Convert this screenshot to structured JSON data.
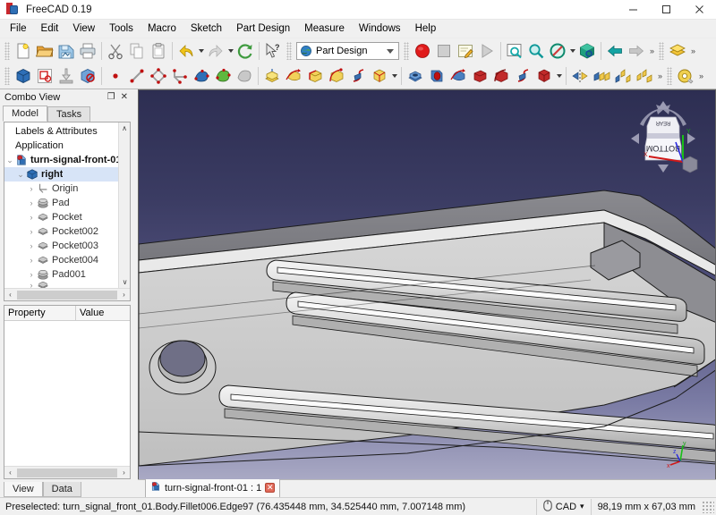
{
  "window": {
    "title": "FreeCAD 0.19",
    "app_icon": "freecad-logo-icon",
    "minimize": "–",
    "maximize": "☐",
    "close": "✕"
  },
  "menubar": {
    "items": [
      {
        "label": "File"
      },
      {
        "label": "Edit"
      },
      {
        "label": "View"
      },
      {
        "label": "Tools"
      },
      {
        "label": "Macro"
      },
      {
        "label": "Sketch"
      },
      {
        "label": "Part Design"
      },
      {
        "label": "Measure"
      },
      {
        "label": "Windows"
      },
      {
        "label": "Help"
      }
    ]
  },
  "toolbars": {
    "row1": [
      {
        "name": "new-document-button",
        "icon": "new-document-icon"
      },
      {
        "name": "open-document-button",
        "icon": "open-folder-icon"
      },
      {
        "name": "save-document-button",
        "icon": "save-icon"
      },
      {
        "name": "print-button",
        "icon": "printer-icon"
      },
      {
        "name": "separator",
        "icon": "separator"
      },
      {
        "name": "cut-button",
        "icon": "scissors-icon"
      },
      {
        "name": "copy-button",
        "icon": "copy-icon"
      },
      {
        "name": "paste-button",
        "icon": "clipboard-paste-icon"
      },
      {
        "name": "separator",
        "icon": "separator"
      },
      {
        "name": "undo-button",
        "icon": "undo-arrow-icon",
        "dropdown": true
      },
      {
        "name": "redo-button",
        "icon": "redo-arrow-icon",
        "dropdown": true
      },
      {
        "name": "refresh-button",
        "icon": "refresh-icon"
      },
      {
        "name": "separator",
        "icon": "separator"
      },
      {
        "name": "whats-this-button",
        "icon": "cursor-question-icon"
      }
    ],
    "workbench_selector": {
      "name": "workbench-selector",
      "value": "Part Design",
      "icon": "workbench-icon"
    },
    "row1b": [
      {
        "name": "macro-record-button",
        "icon": "record-red-circle-icon"
      },
      {
        "name": "macro-stop-button",
        "icon": "stop-square-icon"
      },
      {
        "name": "macro-edit-button",
        "icon": "macro-edit-icon"
      },
      {
        "name": "macro-execute-button",
        "icon": "play-triangle-icon"
      },
      {
        "name": "separator",
        "icon": "separator"
      },
      {
        "name": "fit-all-button",
        "icon": "fit-all-icon"
      },
      {
        "name": "fit-selection-button",
        "icon": "zoom-magnifier-icon"
      },
      {
        "name": "draw-style-button",
        "icon": "draw-style-icon",
        "dropdown": true
      },
      {
        "name": "axonometric-view-button",
        "icon": "isometric-cube-icon"
      },
      {
        "name": "separator",
        "icon": "separator"
      },
      {
        "name": "previous-view-button",
        "icon": "arrow-left-icon"
      },
      {
        "name": "next-view-button",
        "icon": "arrow-right-icon"
      },
      {
        "name": "overflow-button",
        "icon": "chevron-double-right-icon"
      },
      {
        "name": "separator",
        "icon": "separator"
      },
      {
        "name": "structure-button",
        "icon": "yellow-layers-icon"
      },
      {
        "name": "overflow-button-2",
        "icon": "chevron-double-right-icon"
      }
    ],
    "row2": [
      {
        "name": "create-body-button",
        "icon": "blue-body-icon"
      },
      {
        "name": "create-sketch-button",
        "icon": "create-sketch-icon"
      },
      {
        "name": "attach-sketch-button",
        "icon": "attach-sketch-icon"
      },
      {
        "name": "validate-sketch-button",
        "icon": "validate-sketch-icon"
      },
      {
        "name": "separator",
        "icon": "separator"
      },
      {
        "name": "create-point-button",
        "icon": "point-icon"
      },
      {
        "name": "create-line-button",
        "icon": "line-icon"
      },
      {
        "name": "create-polyline-button",
        "icon": "polygon-icon"
      },
      {
        "name": "create-plane-button",
        "icon": "datum-plane-icon"
      },
      {
        "name": "create-datum-plane-button",
        "icon": "blue-plane-icon"
      },
      {
        "name": "create-shapebinder-button",
        "icon": "green-shapebinder-icon"
      },
      {
        "name": "create-subshapebinder-button",
        "icon": "grey-shapebinder-icon"
      },
      {
        "name": "separator",
        "icon": "separator"
      },
      {
        "name": "pad-button",
        "icon": "pad-yellow-icon"
      },
      {
        "name": "revolution-button",
        "icon": "revolution-icon"
      },
      {
        "name": "additive-loft-button",
        "icon": "loft-icon"
      },
      {
        "name": "additive-pipe-button",
        "icon": "pipe-icon"
      },
      {
        "name": "additive-helix-button",
        "icon": "helix-icon"
      },
      {
        "name": "additive-primitive-button",
        "icon": "additive-box-icon",
        "dropdown": true
      },
      {
        "name": "separator",
        "icon": "separator"
      },
      {
        "name": "pocket-button",
        "icon": "pocket-icon"
      },
      {
        "name": "hole-button",
        "icon": "hole-icon"
      },
      {
        "name": "groove-button",
        "icon": "groove-icon"
      },
      {
        "name": "subtractive-loft-button",
        "icon": "subtractive-loft-icon"
      },
      {
        "name": "subtractive-pipe-button",
        "icon": "subtractive-pipe-icon"
      },
      {
        "name": "subtractive-helix-button",
        "icon": "subtractive-helix-icon"
      },
      {
        "name": "subtractive-primitive-button",
        "icon": "subtractive-box-icon",
        "dropdown": true
      },
      {
        "name": "separator",
        "icon": "separator"
      },
      {
        "name": "mirrored-button",
        "icon": "mirrored-icon"
      },
      {
        "name": "linear-pattern-button",
        "icon": "linear-pattern-icon"
      },
      {
        "name": "polar-pattern-button",
        "icon": "polar-pattern-icon"
      },
      {
        "name": "multi-transform-button",
        "icon": "multi-transform-icon"
      },
      {
        "name": "overflow-button-3",
        "icon": "chevron-double-right-icon"
      },
      {
        "name": "separator",
        "icon": "separator"
      },
      {
        "name": "measure-button",
        "icon": "measure-tape-icon"
      },
      {
        "name": "overflow-button-4",
        "icon": "chevron-double-right-icon"
      }
    ]
  },
  "combo_view": {
    "title": "Combo View",
    "float_button": "❐",
    "close_button": "✕",
    "tabs": [
      {
        "label": "Model",
        "active": true
      },
      {
        "label": "Tasks",
        "active": false
      }
    ],
    "tree": {
      "header": "Labels & Attributes",
      "items": [
        {
          "label": "Application",
          "depth": 0,
          "expander": "",
          "icon": "none",
          "bold": false,
          "selected": false
        },
        {
          "label": "turn-signal-front-01",
          "depth": 0,
          "expander": "⌄",
          "icon": "document-icon",
          "bold": true,
          "selected": false
        },
        {
          "label": "right",
          "depth": 1,
          "expander": "⌄",
          "icon": "body-icon",
          "bold": true,
          "selected": true
        },
        {
          "label": "Origin",
          "depth": 2,
          "expander": "›",
          "icon": "origin-icon",
          "bold": false,
          "selected": false
        },
        {
          "label": "Pad",
          "depth": 2,
          "expander": "›",
          "icon": "pad-tree-icon",
          "bold": false,
          "selected": false
        },
        {
          "label": "Pocket",
          "depth": 2,
          "expander": "›",
          "icon": "pocket-tree-icon",
          "bold": false,
          "selected": false
        },
        {
          "label": "Pocket002",
          "depth": 2,
          "expander": "›",
          "icon": "pocket-tree-icon",
          "bold": false,
          "selected": false
        },
        {
          "label": "Pocket003",
          "depth": 2,
          "expander": "›",
          "icon": "pocket-tree-icon",
          "bold": false,
          "selected": false
        },
        {
          "label": "Pocket004",
          "depth": 2,
          "expander": "›",
          "icon": "pocket-tree-icon",
          "bold": false,
          "selected": false
        },
        {
          "label": "Pad001",
          "depth": 2,
          "expander": "›",
          "icon": "pad-tree-icon",
          "bold": false,
          "selected": false
        }
      ],
      "scroll_up": "∧",
      "scroll_down": "∨",
      "scroll_left": "‹",
      "scroll_right": "›"
    },
    "property_editor": {
      "columns": [
        "Property",
        "Value"
      ],
      "rows": [],
      "scroll_left": "‹",
      "scroll_right": "›"
    },
    "bottom_tabs": [
      {
        "label": "View",
        "active": true
      },
      {
        "label": "Data",
        "active": false
      }
    ]
  },
  "view3d": {
    "navcube": {
      "top_face": "REAR",
      "front_face": "BOTTOM",
      "axis_x": "X",
      "axis_y": "Y",
      "axis_z": "Z"
    },
    "axis_cross": {
      "x": "x",
      "y": "y",
      "z": "z"
    },
    "background_top": "#2d2e52",
    "background_bottom": "#a9a9c4",
    "model_color": "#c8c8c8",
    "tab": {
      "label": "turn-signal-front-01 : 1",
      "icon": "freecad-document-icon",
      "close": "✕"
    }
  },
  "statusbar": {
    "message": "Preselected: turn_signal_front_01.Body.Fillet006.Edge97 (76.435448 mm, 34.525440 mm, 7.007148 mm)",
    "nav_style": {
      "label": "CAD",
      "icon": "mouse-icon",
      "caret": "▾"
    },
    "dimensions": "98,19 mm x 67,03 mm"
  }
}
